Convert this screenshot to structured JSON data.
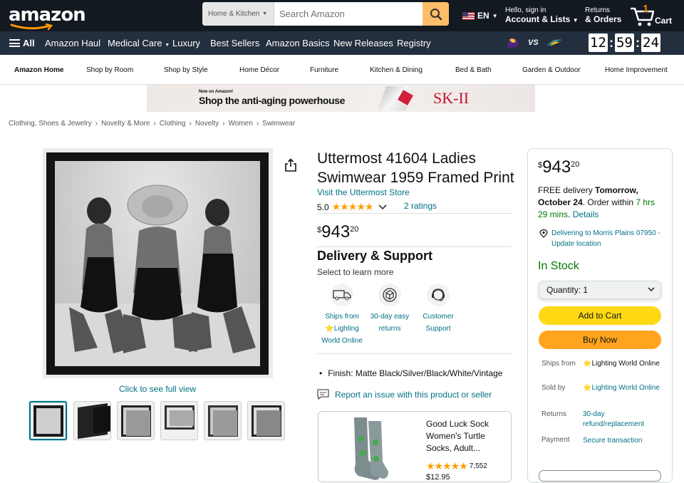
{
  "nav": {
    "logo": "amazon",
    "search_category": "Home & Kitchen",
    "search_placeholder": "Search Amazon",
    "language": "EN",
    "account_line1": "Hello, sign in",
    "account_line2": "Account & Lists",
    "returns_line1": "Returns",
    "returns_line2": "& Orders",
    "cart_count": "1",
    "cart_label": "Cart"
  },
  "subnav": {
    "all": "All",
    "items": [
      "Amazon Haul",
      "Medical Care",
      "Luxury",
      "Best Sellers",
      "Amazon Basics",
      "New Releases",
      "Registry"
    ],
    "vs": "VS",
    "timer": [
      "12",
      "59",
      "24"
    ]
  },
  "storenav": {
    "items": [
      "Amazon Home",
      "Shop by Room",
      "Shop by Style",
      "Home Décor",
      "Furniture",
      "Kitchen & Dining",
      "Bed & Bath",
      "Garden & Outdoor",
      "Home Improvement"
    ]
  },
  "banner": {
    "line1": "New on Amazon!",
    "line2": "Shop the anti-aging powerhouse",
    "brand": "SK-II"
  },
  "breadcrumb": [
    "Clothing, Shoes & Jewelry",
    "Novelty & More",
    "Clothing",
    "Novelty",
    "Women",
    "Swimwear"
  ],
  "gallery": {
    "full_view": "Click to see full view",
    "thumb_count": 6
  },
  "product": {
    "title": "Uttermost 41604 Ladies Swimwear 1959 Framed Print",
    "store_link": "Visit the Uttermost Store",
    "rating": "5.0",
    "stars": "★★★★★",
    "ratings_count": "2 ratings",
    "price_symbol": "$",
    "price_whole": "943",
    "price_fraction": "20",
    "delivery_heading": "Delivery & Support",
    "delivery_sub": "Select to learn more",
    "features": [
      {
        "line1": "Ships from",
        "line2": "⭐Lighting",
        "line3": "World Online",
        "icon": "truck-icon"
      },
      {
        "line1": "30-day easy",
        "line2": "returns",
        "line3": "",
        "icon": "return-box-icon"
      },
      {
        "line1": "Customer",
        "line2": "Support",
        "line3": "",
        "icon": "headset-icon"
      }
    ],
    "finish": "Finish: Matte Black/Silver/Black/White/Vintage",
    "report": "Report an issue with this product or seller"
  },
  "ad": {
    "title": "Good Luck Sock Women's Turtle Socks, Adult...",
    "stars": "★★★★★",
    "reviews": "7,552",
    "price": "$12.95"
  },
  "buybox": {
    "price_symbol": "$",
    "price_whole": "943",
    "price_fraction": "20",
    "free_delivery": "FREE delivery",
    "date": "Tomorrow, October 24",
    "order_within": ". Order within",
    "countdown": "7 hrs 29 mins",
    "details": "Details",
    "location": "Delivering to Morris Plains 07950 - Update location",
    "in_stock": "In Stock",
    "quantity_label": "Quantity:",
    "quantity_value": "1",
    "add_to_cart": "Add to Cart",
    "buy_now": "Buy Now",
    "ships_from_label": "Ships from",
    "ships_from_value": "⭐Lighting World Online",
    "sold_by_label": "Sold by",
    "sold_by_value": "⭐Lighting World Online",
    "returns_label": "Returns",
    "returns_value": "30-day refund/replacement",
    "payment_label": "Payment",
    "payment_value": "Secure transaction"
  },
  "colors": {
    "nav_bg": "#131921",
    "subnav_bg": "#232f3e",
    "link": "#007185",
    "star": "#ff9f00",
    "add_to_cart": "#ffd814",
    "buy_now": "#ffa41c",
    "in_stock": "#007600"
  }
}
